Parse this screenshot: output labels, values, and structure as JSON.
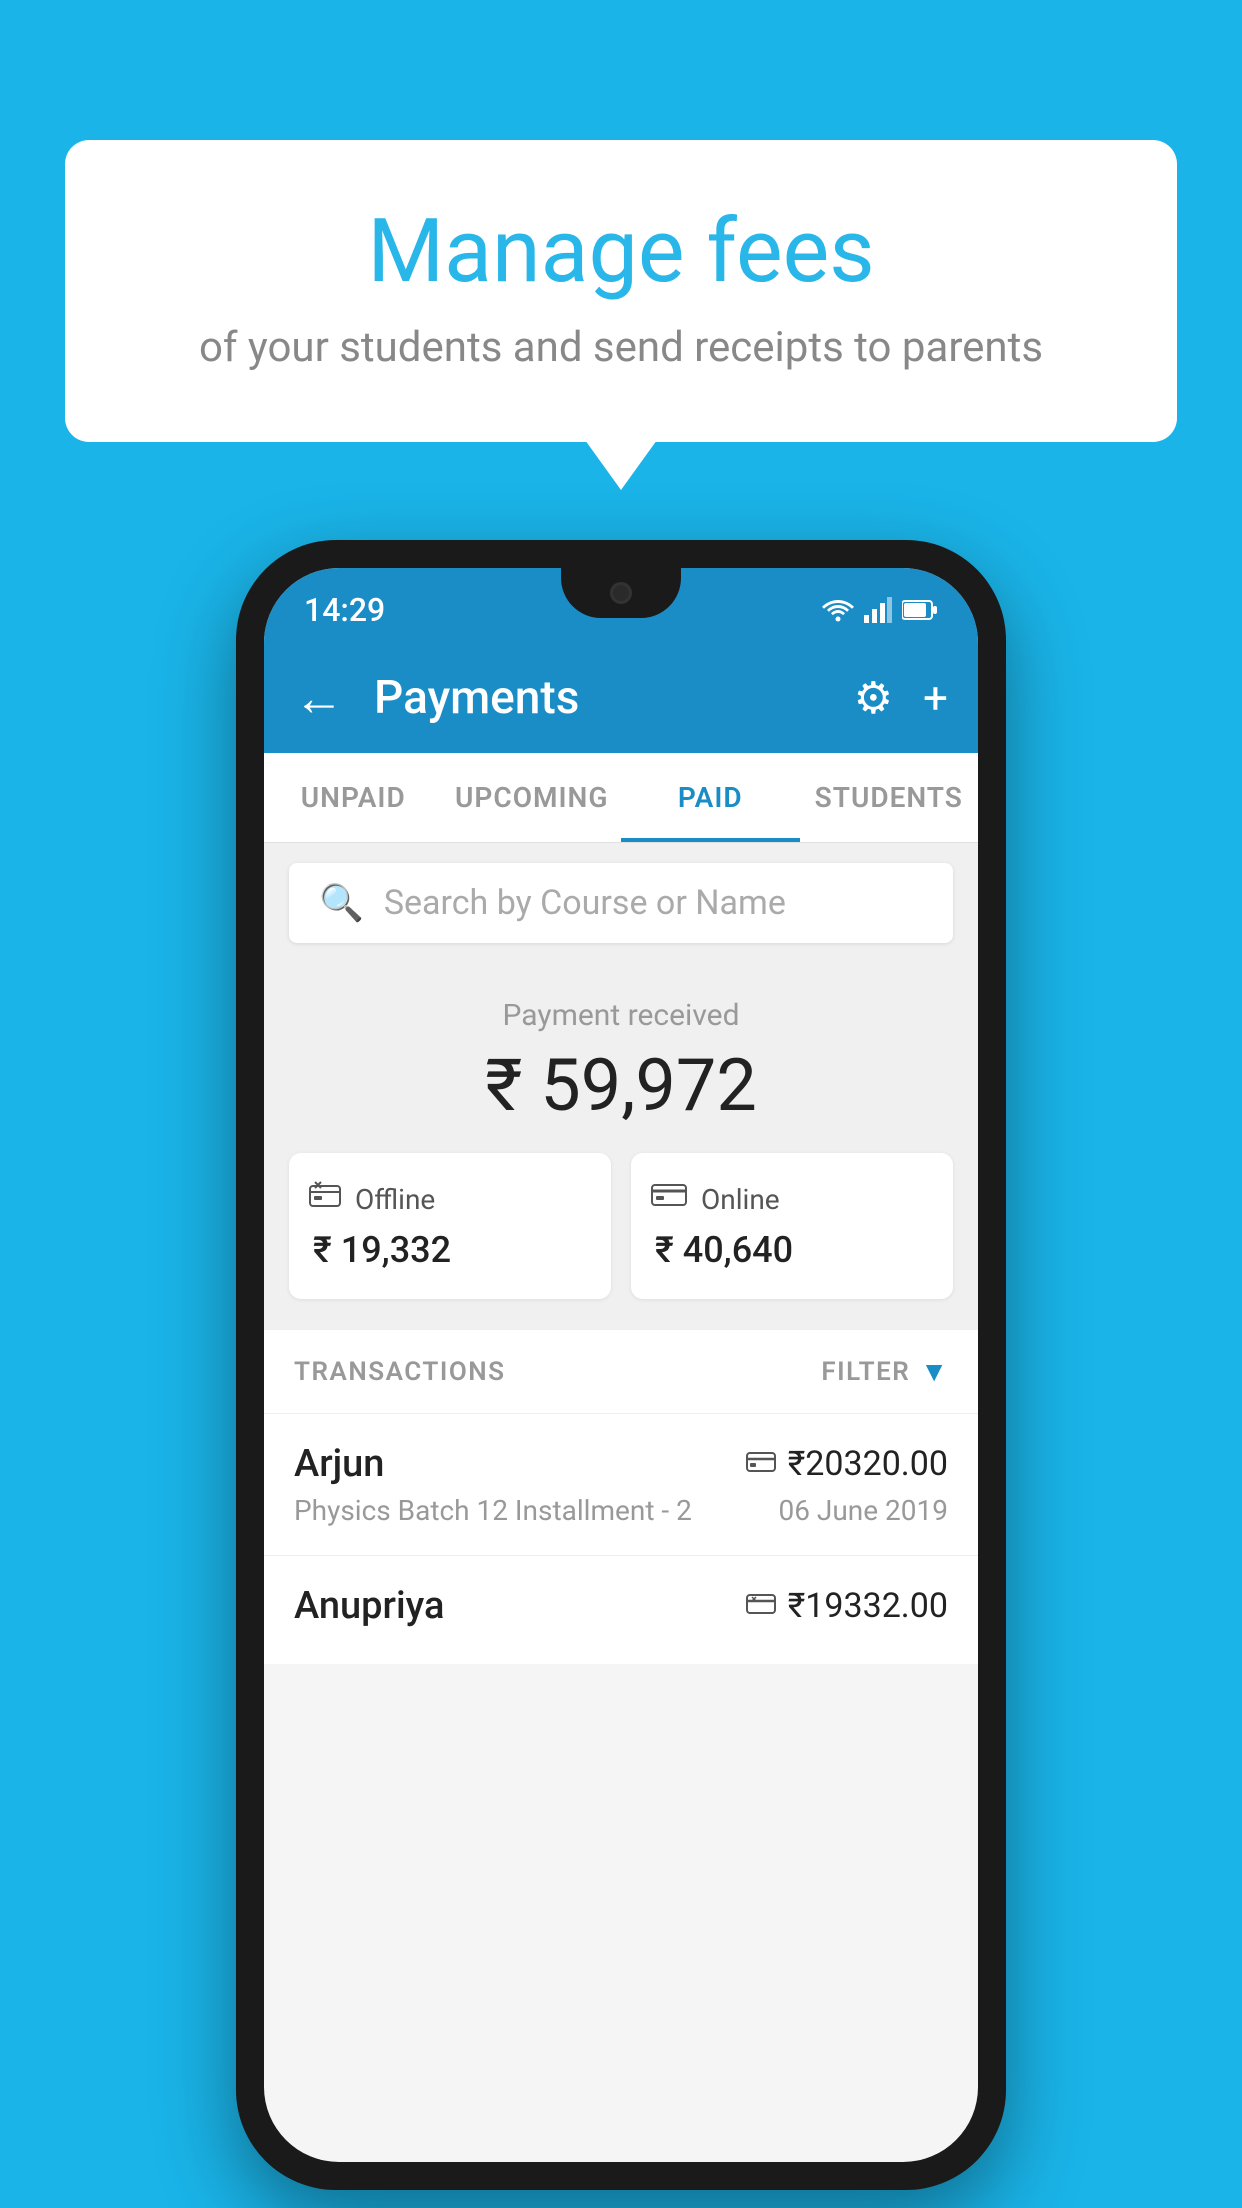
{
  "background_color": "#1ab4e8",
  "speech_bubble": {
    "title": "Manage fees",
    "subtitle": "of your students and send receipts to parents"
  },
  "status_bar": {
    "time": "14:29",
    "icons": [
      "wifi",
      "signal",
      "battery"
    ]
  },
  "app_bar": {
    "title": "Payments",
    "back_label": "←",
    "settings_label": "⚙",
    "add_label": "+"
  },
  "tabs": [
    {
      "label": "UNPAID",
      "active": false
    },
    {
      "label": "UPCOMING",
      "active": false
    },
    {
      "label": "PAID",
      "active": true
    },
    {
      "label": "STUDENTS",
      "active": false
    }
  ],
  "search": {
    "placeholder": "Search by Course or Name"
  },
  "payment_summary": {
    "received_label": "Payment received",
    "total_amount": "₹ 59,972",
    "offline": {
      "label": "Offline",
      "amount": "₹ 19,332"
    },
    "online": {
      "label": "Online",
      "amount": "₹ 40,640"
    }
  },
  "transactions": {
    "header_label": "TRANSACTIONS",
    "filter_label": "FILTER",
    "rows": [
      {
        "name": "Arjun",
        "amount": "₹20320.00",
        "type": "online",
        "course": "Physics Batch 12 Installment - 2",
        "date": "06 June 2019"
      },
      {
        "name": "Anupriya",
        "amount": "₹19332.00",
        "type": "offline",
        "course": "",
        "date": ""
      }
    ]
  }
}
